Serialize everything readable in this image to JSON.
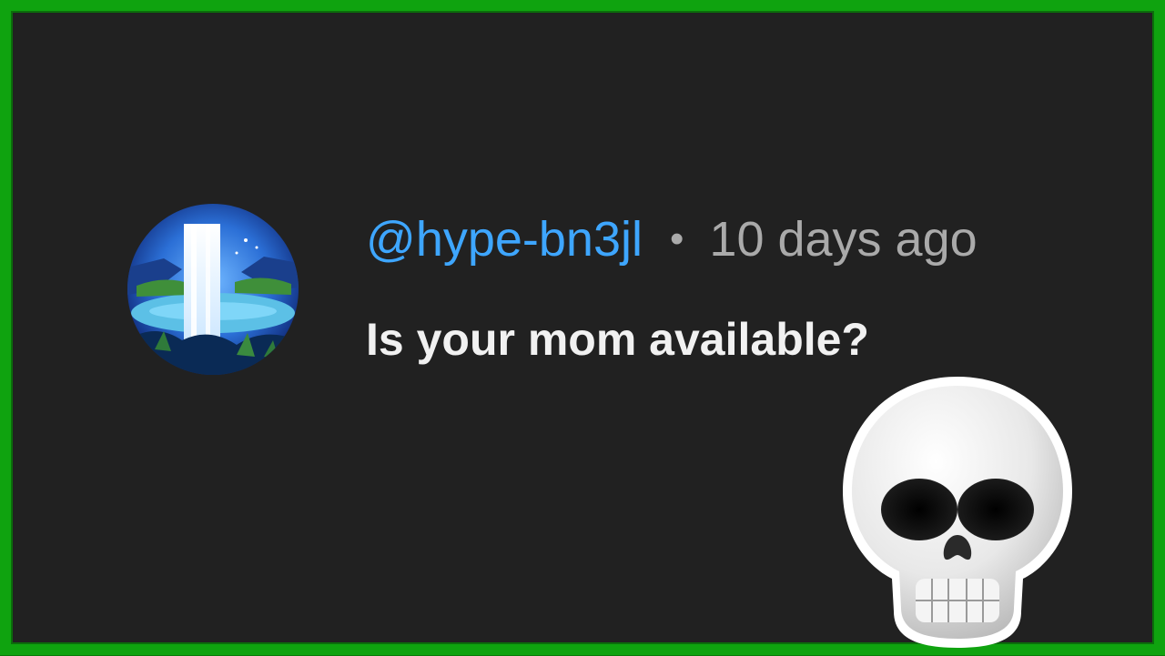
{
  "comment": {
    "author_handle": "@hype-bn3jl",
    "separator": "•",
    "timestamp": "10 days ago",
    "text": "Is your mom available?",
    "avatar_icon": "waterfall-avatar-icon"
  },
  "reaction": {
    "icon": "skull-emoji-icon"
  },
  "colors": {
    "frame_border": "#0fa30f",
    "background": "#212121",
    "handle": "#3ea6ff",
    "timestamp": "#aaaaaa",
    "comment_text": "#f1f1f1"
  }
}
